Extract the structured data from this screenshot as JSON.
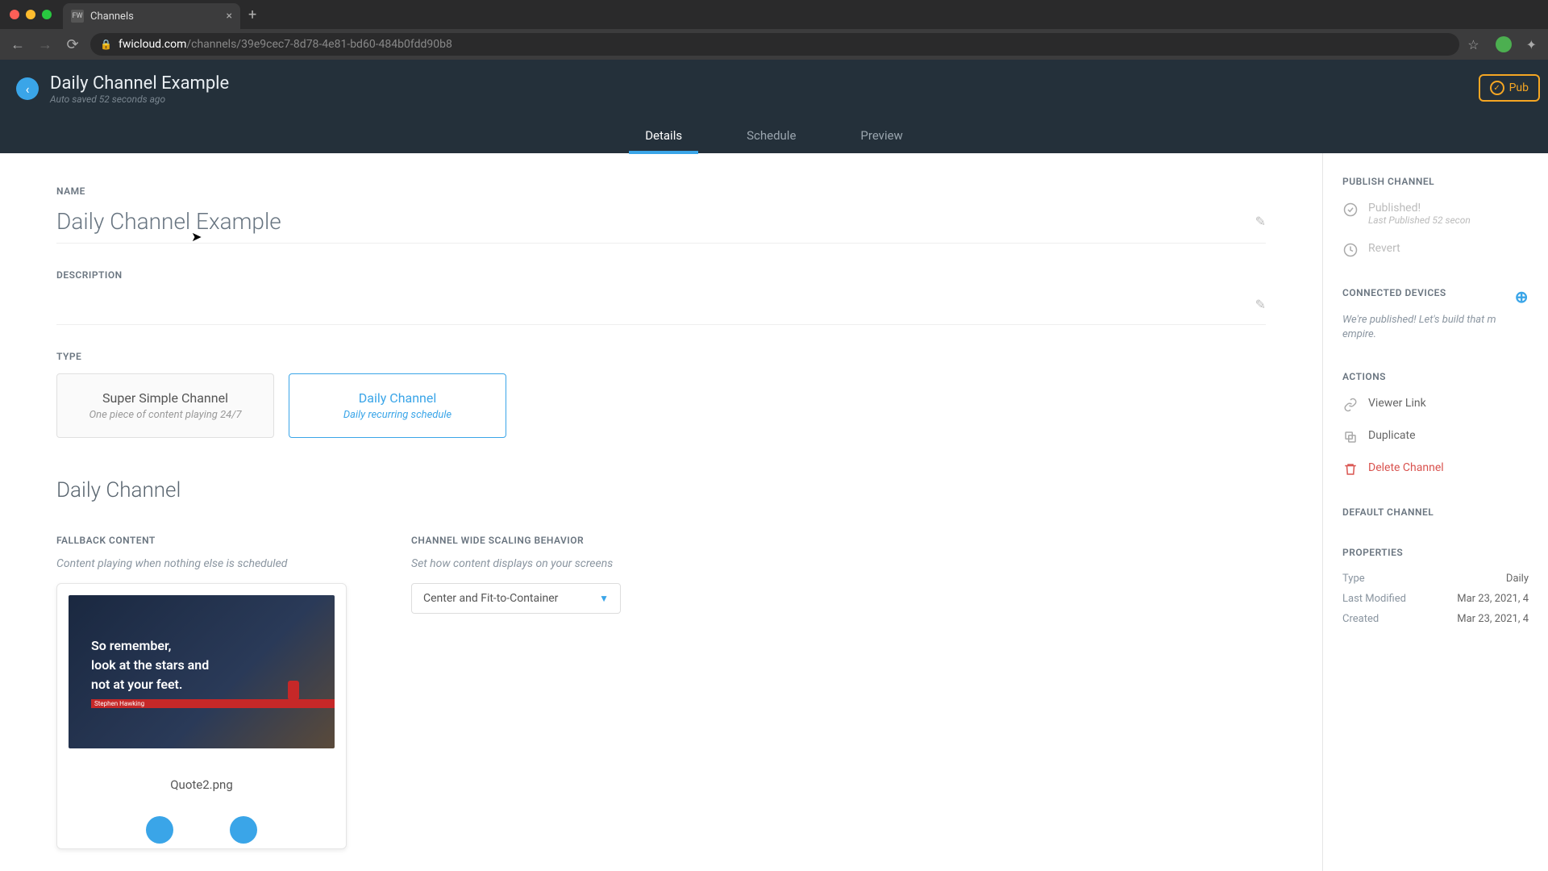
{
  "browser": {
    "tab_title": "Channels",
    "tab_favicon": "FW",
    "url_domain": "fwicloud.com",
    "url_path": "/channels/39e9cec7-8d78-4e81-bd60-484b0fdd90b8"
  },
  "header": {
    "title": "Daily Channel Example",
    "autosave": "Auto saved 52 seconds ago",
    "publish_label": "Pub"
  },
  "tabs": {
    "details": "Details",
    "schedule": "Schedule",
    "preview": "Preview"
  },
  "form": {
    "name_label": "NAME",
    "name_value": "Daily Channel Example",
    "desc_label": "DESCRIPTION",
    "desc_value": "",
    "type_label": "TYPE",
    "type_options": [
      {
        "title": "Super Simple Channel",
        "sub": "One piece of content playing 24/7"
      },
      {
        "title": "Daily Channel",
        "sub": "Daily recurring schedule"
      }
    ],
    "section_heading": "Daily Channel",
    "fallback_label": "FALLBACK CONTENT",
    "fallback_hint": "Content playing when nothing else is scheduled",
    "fallback_file": "Quote2.png",
    "quote_l1": "So remember,",
    "quote_l2": "look at the stars and",
    "quote_l3": "not at your feet.",
    "quote_attr": "Stephen Hawking",
    "scaling_label": "CHANNEL WIDE SCALING BEHAVIOR",
    "scaling_hint": "Set how content displays on your screens",
    "scaling_value": "Center and Fit-to-Container"
  },
  "sidebar": {
    "publish_label": "PUBLISH CHANNEL",
    "published_title": "Published!",
    "published_sub": "Last Published 52 secon",
    "revert": "Revert",
    "devices_label": "CONNECTED DEVICES",
    "devices_msg": "We're published! Let's build that m empire.",
    "actions_label": "ACTIONS",
    "viewer_link": "Viewer Link",
    "duplicate": "Duplicate",
    "delete": "Delete Channel",
    "default_label": "DEFAULT CHANNEL",
    "props_label": "PROPERTIES",
    "props": {
      "type_k": "Type",
      "type_v": "Daily",
      "mod_k": "Last Modified",
      "mod_v": "Mar 23, 2021, 4",
      "created_k": "Created",
      "created_v": "Mar 23, 2021, 4"
    }
  }
}
